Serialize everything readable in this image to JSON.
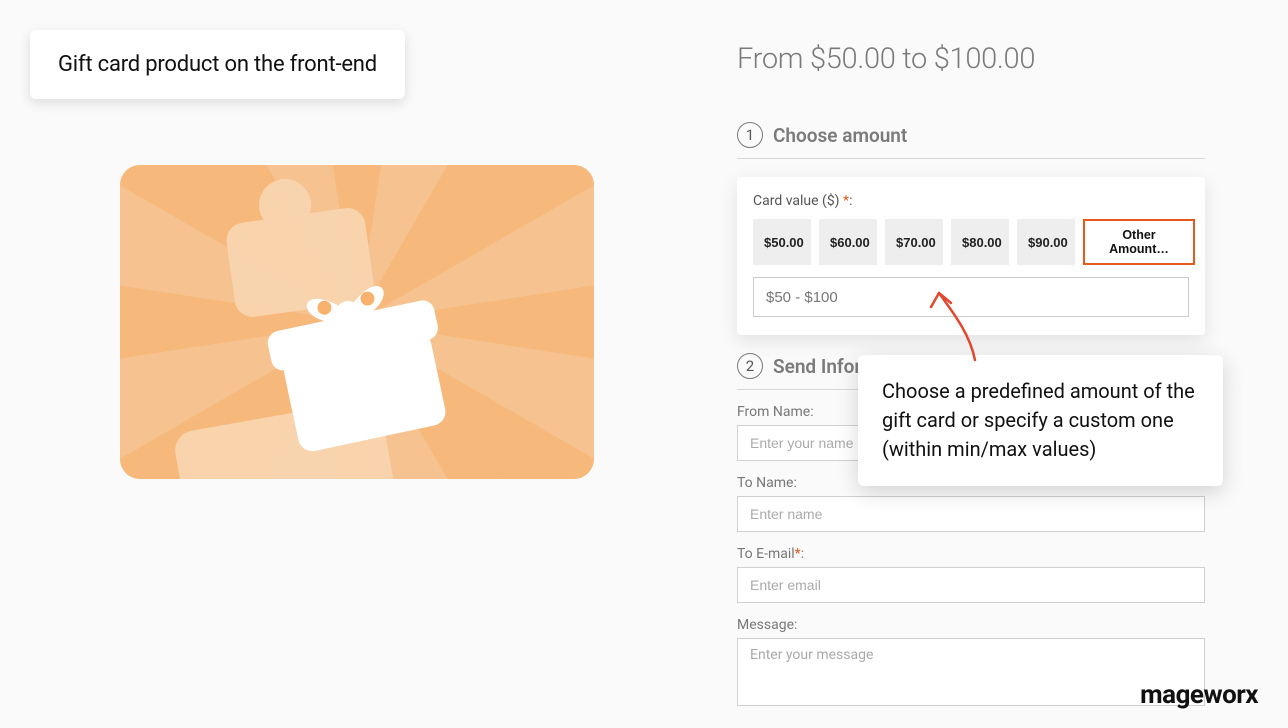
{
  "callout_title": "Gift card product on the front-end",
  "price_range": "From $50.00 to $100.00",
  "step1": {
    "num": "1",
    "title": "Choose amount"
  },
  "card_value": {
    "label": "Card value ($) ",
    "req": "*",
    "amounts": [
      "$50.00",
      "$60.00",
      "$70.00",
      "$80.00",
      "$90.00"
    ],
    "other_label": "Other Amount…",
    "input_placeholder": "$50 - $100"
  },
  "step2": {
    "num": "2",
    "title": "Send Information"
  },
  "fields": {
    "from_name": {
      "label": "From Name:",
      "placeholder": "Enter your name"
    },
    "to_name": {
      "label": "To Name:",
      "placeholder": "Enter name"
    },
    "to_email": {
      "label": "To E-mail",
      "req": "*",
      "placeholder": "Enter email"
    },
    "message": {
      "label": "Message:",
      "placeholder": "Enter your message"
    }
  },
  "explain": "Choose a predefined amount of the gift card or specify a custom one (within min/max values)",
  "brand": "mageworx"
}
